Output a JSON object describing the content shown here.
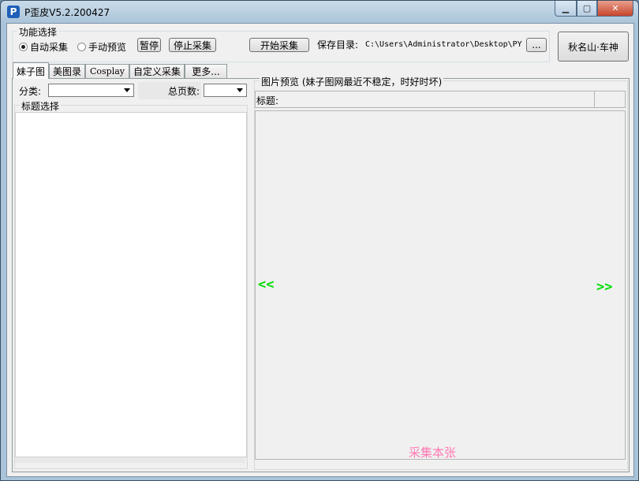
{
  "window": {
    "title": "P歪皮V5.2.200427",
    "app_icon_letter": "P",
    "buttons": {
      "minimize": "▁",
      "maximize": "▢",
      "close": "✕"
    }
  },
  "function_group": {
    "title": "功能选择",
    "radio_auto": "自动采集",
    "radio_manual": "手动预览",
    "selected": "自动采集",
    "pause_button": "暂停",
    "stop_button": "停止采集",
    "start_button": "开始采集",
    "save_dir_label": "保存目录:",
    "save_dir_value": "C:\\Users\\Administrator\\Desktop\\PY",
    "browse_button": "..."
  },
  "author_button": "秋名山·车神",
  "tabs": [
    {
      "label": "妹子图",
      "active": true
    },
    {
      "label": "美图录",
      "active": false
    },
    {
      "label": "Cosplay",
      "active": false
    },
    {
      "label": "自定义采集",
      "active": false
    },
    {
      "label": "更多...",
      "active": false
    }
  ],
  "left_panel": {
    "category_label": "分类:",
    "category_value": "",
    "total_pages_label": "总页数:",
    "total_pages_value": "",
    "title_group": "标题选择"
  },
  "preview": {
    "group_title": "图片预览 (妹子图网最近不稳定，时好时坏)",
    "title_label": "标题:",
    "title_value": "",
    "prev_button": "<<",
    "next_button": ">>",
    "grab_button": "采集本张"
  },
  "colors": {
    "nav_arrows": "#00dd00",
    "grab_link": "#ff7ab4"
  }
}
